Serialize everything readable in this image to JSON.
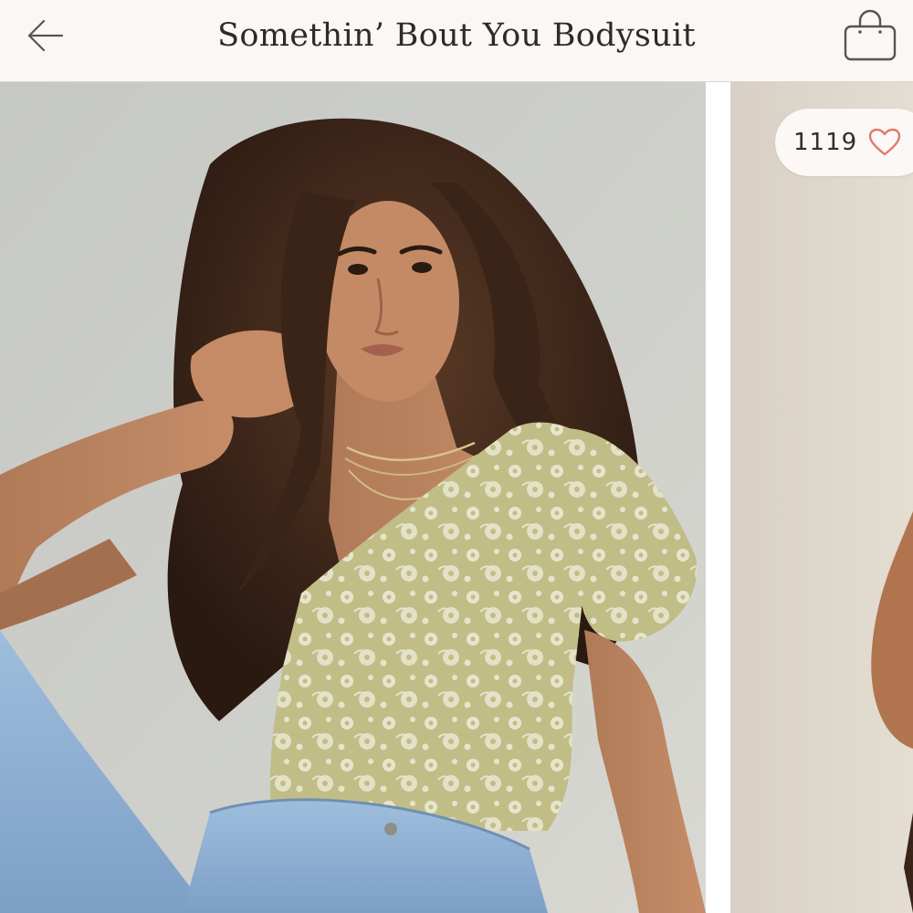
{
  "header": {
    "title": "Somethin’ Bout You Bodysuit",
    "back_icon": "arrow-left-icon",
    "bag_icon": "shopping-bag-icon"
  },
  "gallery": {
    "likes": {
      "count": "1119",
      "icon": "heart-outline-icon"
    },
    "images": [
      {
        "name": "product-photo-model-front"
      },
      {
        "name": "product-photo-next-partial"
      }
    ]
  },
  "colors": {
    "header_bg": "#fbf7f5",
    "text": "#2b2b2b",
    "heart": "#e07a6e",
    "top_print": "#c3bf8b",
    "denim": "#8fb0d3"
  }
}
